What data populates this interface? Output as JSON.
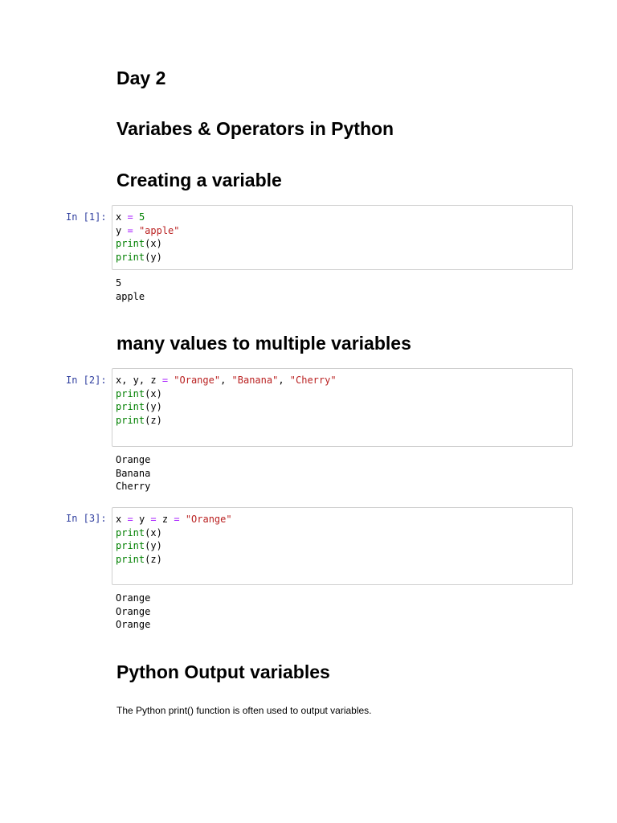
{
  "headings": {
    "day": "Day 2",
    "title": "Variabes & Operators in Python",
    "creating": "Creating a variable",
    "many_values": "many values to multiple variables",
    "output_vars": "Python Output variables"
  },
  "cells": [
    {
      "prompt": "In [1]:",
      "lines": [
        [
          {
            "t": "x",
            "c": "var"
          },
          {
            "t": " ",
            "c": "punc"
          },
          {
            "t": "=",
            "c": "op"
          },
          {
            "t": " ",
            "c": "punc"
          },
          {
            "t": "5",
            "c": "num"
          }
        ],
        [
          {
            "t": "y",
            "c": "var"
          },
          {
            "t": " ",
            "c": "punc"
          },
          {
            "t": "=",
            "c": "op"
          },
          {
            "t": " ",
            "c": "punc"
          },
          {
            "t": "\"apple\"",
            "c": "str"
          }
        ],
        [
          {
            "t": "print",
            "c": "builtin"
          },
          {
            "t": "(x)",
            "c": "punc"
          }
        ],
        [
          {
            "t": "print",
            "c": "builtin"
          },
          {
            "t": "(y)",
            "c": "punc"
          }
        ]
      ],
      "output": [
        "5",
        "apple"
      ]
    },
    {
      "prompt": "In [2]:",
      "lines": [
        [
          {
            "t": "x, y, z",
            "c": "var"
          },
          {
            "t": " ",
            "c": "punc"
          },
          {
            "t": "=",
            "c": "op"
          },
          {
            "t": " ",
            "c": "punc"
          },
          {
            "t": "\"Orange\"",
            "c": "str"
          },
          {
            "t": ", ",
            "c": "punc"
          },
          {
            "t": "\"Banana\"",
            "c": "str"
          },
          {
            "t": ", ",
            "c": "punc"
          },
          {
            "t": "\"Cherry\"",
            "c": "str"
          }
        ],
        [
          {
            "t": "print",
            "c": "builtin"
          },
          {
            "t": "(x)",
            "c": "punc"
          }
        ],
        [
          {
            "t": "print",
            "c": "builtin"
          },
          {
            "t": "(y)",
            "c": "punc"
          }
        ],
        [
          {
            "t": "print",
            "c": "builtin"
          },
          {
            "t": "(z)",
            "c": "punc"
          }
        ]
      ],
      "output": [
        "Orange",
        "Banana",
        "Cherry"
      ]
    },
    {
      "prompt": "In [3]:",
      "lines": [
        [
          {
            "t": "x",
            "c": "var"
          },
          {
            "t": " ",
            "c": "punc"
          },
          {
            "t": "=",
            "c": "op"
          },
          {
            "t": " ",
            "c": "punc"
          },
          {
            "t": "y",
            "c": "var"
          },
          {
            "t": " ",
            "c": "punc"
          },
          {
            "t": "=",
            "c": "op"
          },
          {
            "t": " ",
            "c": "punc"
          },
          {
            "t": "z",
            "c": "var"
          },
          {
            "t": " ",
            "c": "punc"
          },
          {
            "t": "=",
            "c": "op"
          },
          {
            "t": " ",
            "c": "punc"
          },
          {
            "t": "\"Orange\"",
            "c": "str"
          }
        ],
        [
          {
            "t": "print",
            "c": "builtin"
          },
          {
            "t": "(x)",
            "c": "punc"
          }
        ],
        [
          {
            "t": "print",
            "c": "builtin"
          },
          {
            "t": "(y)",
            "c": "punc"
          }
        ],
        [
          {
            "t": "print",
            "c": "builtin"
          },
          {
            "t": "(z)",
            "c": "punc"
          }
        ]
      ],
      "output": [
        "Orange",
        "Orange",
        "Orange"
      ]
    }
  ],
  "body_text": "The Python print() function is often used to output variables.",
  "colors": {
    "prompt": "#303F9F",
    "number": "#008000",
    "string": "#BA2121",
    "builtin": "#008000",
    "operator": "#AA22FF",
    "cell_border": "#cfcfcf"
  }
}
